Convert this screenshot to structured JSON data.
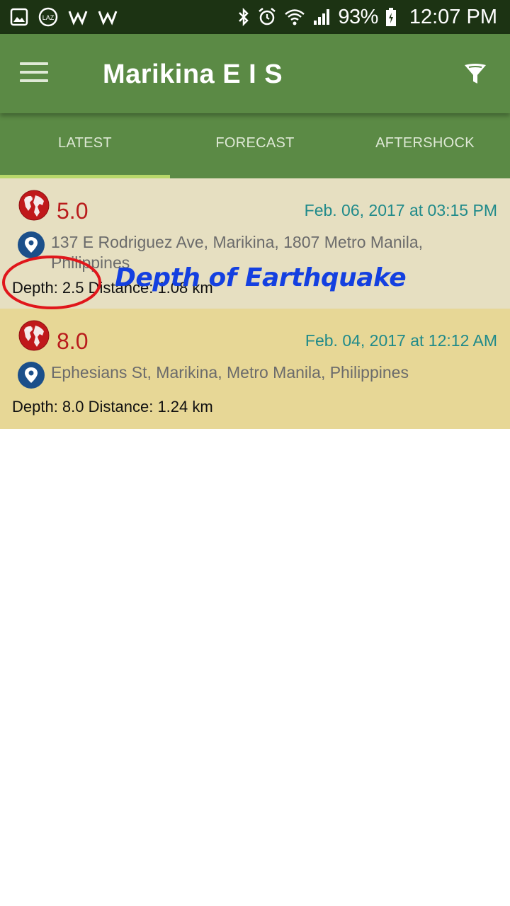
{
  "status_bar": {
    "left_icons": [
      "image-icon",
      "laz-icon",
      "w-icon",
      "w-icon"
    ],
    "right_icons": [
      "bluetooth-icon",
      "alarm-icon",
      "wifi-icon",
      "signal-icon",
      "battery-icon"
    ],
    "battery": "93%",
    "time": "12:07 PM"
  },
  "app_bar": {
    "title": "Marikina E I S",
    "menu_icon": "menu-icon",
    "filter_icon": "filter-icon"
  },
  "tabs": [
    {
      "label": "LATEST",
      "active": true
    },
    {
      "label": "FORECAST",
      "active": false
    },
    {
      "label": "AFTERSHOCK",
      "active": false
    }
  ],
  "quakes": [
    {
      "magnitude": "5.0",
      "datetime": "Feb. 06, 2017 at 03:15 PM",
      "address": "137 E Rodriguez Ave, Marikina, 1807 Metro Manila, Philippines",
      "details": "Depth: 2.5 Distance: 1.08 km"
    },
    {
      "magnitude": "8.0",
      "datetime": "Feb. 04, 2017 at 12:12 AM",
      "address": "Ephesians St, Marikina, Metro Manila, Philippines",
      "details": "Depth: 8.0 Distance: 1.24 km"
    }
  ],
  "annotation": {
    "text": "Depth of Earthquake",
    "color": "#1440e0",
    "circle_color": "#e0161b"
  },
  "colors": {
    "primary": "#5b8a45",
    "status_bar": "#1c3313",
    "tab_indicator": "#b8d86a",
    "magnitude": "#b91c1c",
    "date": "#1f8a8a",
    "card_1": "#e6dfc1",
    "card_2": "#e7d796"
  }
}
